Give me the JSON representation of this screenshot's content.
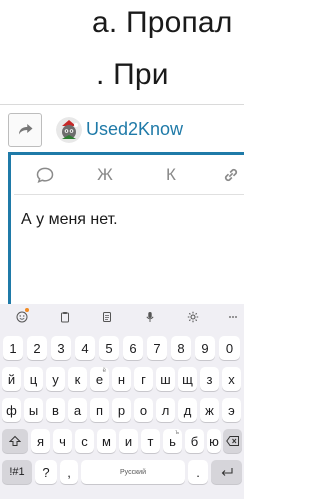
{
  "article": {
    "line1": "а. Пропал",
    "line2": ". При"
  },
  "reply": {
    "username": "Used2Know"
  },
  "toolbar": {
    "bold_label": "Ж",
    "italic_label": "К"
  },
  "composer": {
    "text": "А у меня нет."
  },
  "keyboard": {
    "number_row": [
      "1",
      "2",
      "3",
      "4",
      "5",
      "6",
      "7",
      "8",
      "9",
      "0"
    ],
    "row1": [
      "й",
      "ц",
      "у",
      "к",
      "е",
      "н",
      "г",
      "ш",
      "щ",
      "з",
      "х"
    ],
    "row1_hints": [
      "",
      "",
      "",
      "",
      "ё",
      "",
      "",
      "",
      "",
      "",
      ""
    ],
    "row2": [
      "ф",
      "ы",
      "в",
      "а",
      "п",
      "р",
      "о",
      "л",
      "д",
      "ж",
      "э"
    ],
    "row3": [
      "я",
      "ч",
      "с",
      "м",
      "и",
      "т",
      "ь",
      "б",
      "ю"
    ],
    "row3_hints": [
      "",
      "",
      "",
      "",
      "",
      "",
      "ъ",
      "",
      ""
    ],
    "symbols_label": "!#1",
    "question_label": "?",
    "comma_label": ",",
    "space_label": "Русский",
    "period_label": "."
  },
  "colors": {
    "accent": "#1f7aa8",
    "keyboard_bg": "#f0eff4"
  }
}
